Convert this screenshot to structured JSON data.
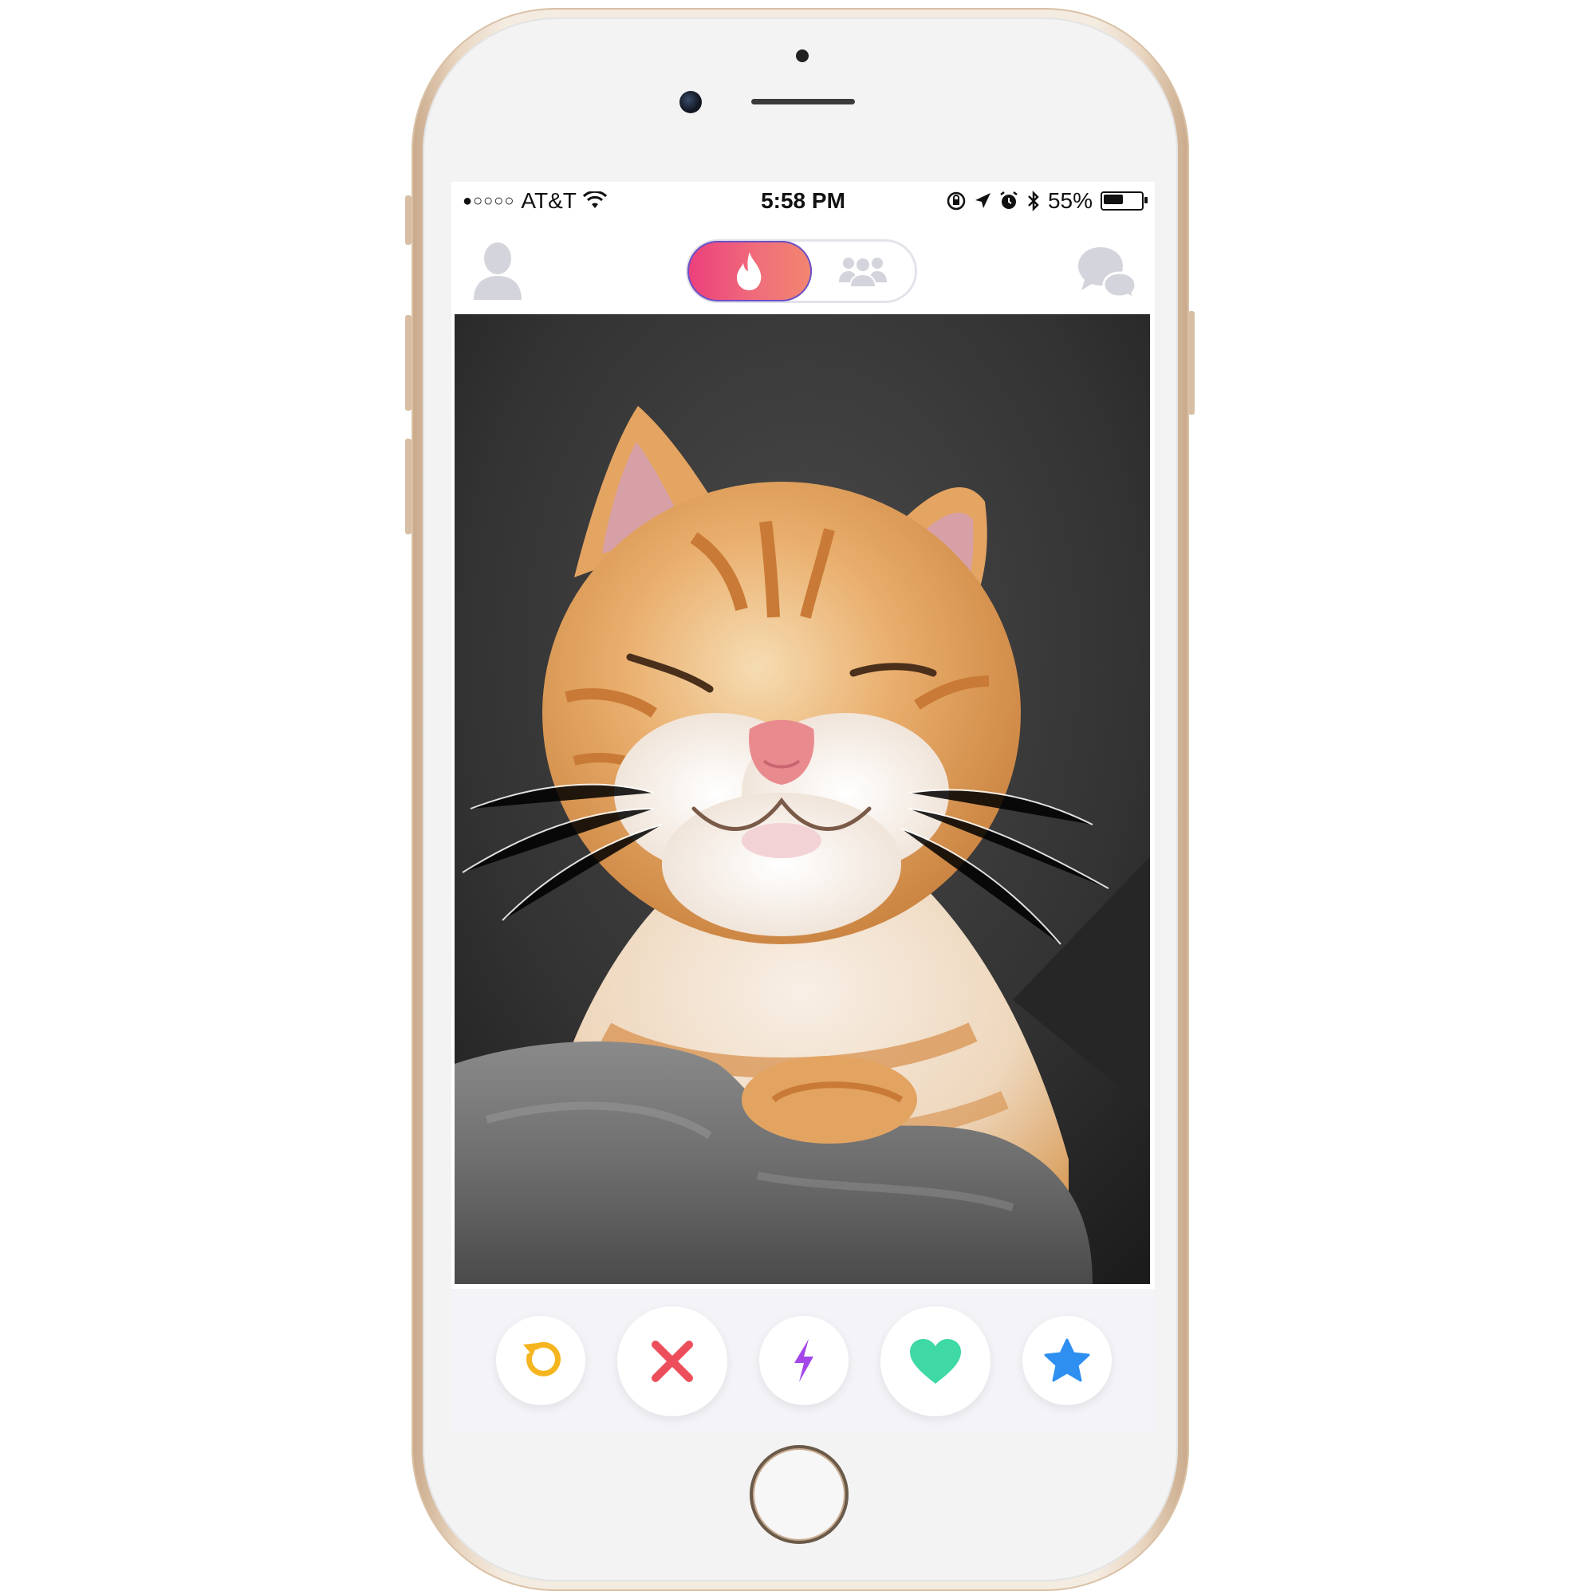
{
  "status_bar": {
    "signal_dots": "●○○○○",
    "carrier": "AT&T",
    "time": "5:58 PM",
    "battery_percent": "55%",
    "battery_level": 0.55
  },
  "nav": {
    "active_tab": "swipe",
    "tabs": [
      {
        "name": "swipe",
        "icon": "flame-icon"
      },
      {
        "name": "group",
        "icon": "group-icon"
      }
    ],
    "left_icon": "profile-icon",
    "right_icon": "chat-icon"
  },
  "card": {
    "photo_subject": "orange-tabby-cat"
  },
  "actions": [
    {
      "name": "rewind",
      "icon": "rewind-icon",
      "color": "#f5b51f"
    },
    {
      "name": "nope",
      "icon": "close-icon",
      "color": "#ec4f5b"
    },
    {
      "name": "boost",
      "icon": "lightning-icon",
      "color": "#a347e8"
    },
    {
      "name": "like",
      "icon": "heart-icon",
      "color": "#3ed9a5"
    },
    {
      "name": "super-like",
      "icon": "star-icon",
      "color": "#2e8ff0"
    }
  ],
  "colors": {
    "brand_gradient_start": "#ec3f7c",
    "brand_gradient_end": "#f2866f",
    "inactive_icon": "#d4d4dc",
    "phone_gold": "#e9d6c1"
  }
}
